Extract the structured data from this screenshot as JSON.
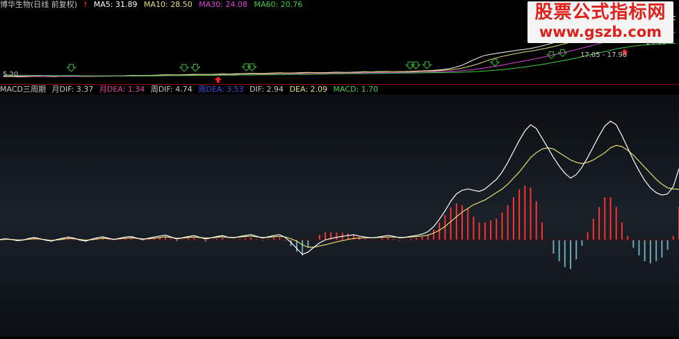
{
  "header": {
    "title": "博华生物(日线 前复权)",
    "ma5": "MA5: 31.89",
    "ma10": "MA10: 28.50",
    "ma30": "MA30: 24.08",
    "ma60": "MA60: 20.76"
  },
  "price_labels": {
    "low": "5.20",
    "right": "24.10",
    "mid": "17.05 - 17.90"
  },
  "macd_legend": {
    "name": "MACD三周期",
    "month_dif": "月DIF: 3.37",
    "month_dea": "月DEA: 1.34",
    "week_dif": "周DIF: 4.74",
    "week_dea": "周DEA: 3.53",
    "dif": "DIF: 2.94",
    "dea": "DEA: 2.09",
    "macd": "MACD: 1.70"
  },
  "watermark": {
    "title": "股票公式指标网",
    "url": "www.gszb.com"
  },
  "colors": {
    "ma5": "#ffffff",
    "ma10": "#e8e070",
    "ma30": "#e040e0",
    "ma60": "#40d040",
    "up_arrow": "#ff2020",
    "down_arrow": "#30c030",
    "month_band": "#c81e68",
    "week_band": "#5a0a12",
    "dif": "#ffffff",
    "dea": "#e8e070",
    "bar_up": "#ff3030",
    "bar_down": "#6fa8b8"
  },
  "chart_data": [
    {
      "type": "line",
      "ylim": [
        4,
        36
      ],
      "x_count": 120,
      "series": [
        {
          "values": [
            5.2,
            5.3,
            5.2,
            5.1,
            5.2,
            5.3,
            5.4,
            5.3,
            5.2,
            5.2,
            5.3,
            5.4,
            5.5,
            5.4,
            5.3,
            5.3,
            5.4,
            5.5,
            5.6,
            5.5,
            5.5,
            5.6,
            5.7,
            5.8,
            5.7,
            5.7,
            5.8,
            5.9,
            6.0,
            6.1,
            6.0,
            6.0,
            6.1,
            6.2,
            6.3,
            6.2,
            6.2,
            6.3,
            6.4,
            6.5,
            6.4,
            6.5,
            6.6,
            6.7,
            6.8,
            6.7,
            6.7,
            6.8,
            6.9,
            7.0,
            6.9,
            6.9,
            7.0,
            7.1,
            7.2,
            7.1,
            7.0,
            7.1,
            7.2,
            7.3,
            7.2,
            7.2,
            7.3,
            7.4,
            7.5,
            7.4,
            7.5,
            7.6,
            7.7,
            7.6,
            7.5,
            7.6,
            7.7,
            7.8,
            7.9,
            8.0,
            8.1,
            8.3,
            8.6,
            9.0,
            9.6,
            10.4,
            11.5,
            12.8,
            14.0,
            15.0,
            15.6,
            16.0,
            16.4,
            16.8,
            17.2,
            17.6,
            17.9,
            18.3,
            18.8,
            19.4,
            20.1,
            20.8,
            21.6,
            22.4,
            23.2,
            24.0,
            24.9,
            25.8,
            26.6,
            27.4,
            28.2,
            29.0,
            29.8,
            30.5,
            31.0,
            31.4,
            31.7,
            31.9,
            32.2,
            32.5,
            32.8,
            33.0,
            33.3,
            33.5
          ]
        },
        {
          "values": [
            5.3,
            5.3,
            5.3,
            5.2,
            5.2,
            5.3,
            5.3,
            5.3,
            5.3,
            5.2,
            5.3,
            5.3,
            5.4,
            5.4,
            5.4,
            5.3,
            5.4,
            5.4,
            5.5,
            5.5,
            5.5,
            5.5,
            5.6,
            5.7,
            5.7,
            5.7,
            5.7,
            5.8,
            5.9,
            6.0,
            6.0,
            6.0,
            6.0,
            6.1,
            6.2,
            6.2,
            6.2,
            6.2,
            6.3,
            6.4,
            6.4,
            6.4,
            6.5,
            6.6,
            6.7,
            6.7,
            6.7,
            6.7,
            6.8,
            6.9,
            6.9,
            6.9,
            6.9,
            7.0,
            7.1,
            7.1,
            7.0,
            7.0,
            7.1,
            7.2,
            7.2,
            7.2,
            7.2,
            7.3,
            7.4,
            7.4,
            7.4,
            7.5,
            7.6,
            7.6,
            7.5,
            7.5,
            7.6,
            7.7,
            7.8,
            7.9,
            7.9,
            8.0,
            8.2,
            8.4,
            8.7,
            9.1,
            9.7,
            10.4,
            11.2,
            12.1,
            13.0,
            13.8,
            14.5,
            15.1,
            15.7,
            16.2,
            16.7,
            17.1,
            17.5,
            18.0,
            18.5,
            19.1,
            19.7,
            20.4,
            21.1,
            21.8,
            22.6,
            23.4,
            24.2,
            25.0,
            25.8,
            26.6,
            27.4,
            28.1,
            28.5,
            29.0,
            29.4,
            29.8,
            30.2,
            30.6,
            31.0,
            31.4,
            31.7,
            32.0
          ]
        },
        {
          "values": [
            5.6,
            5.6,
            5.5,
            5.5,
            5.5,
            5.5,
            5.5,
            5.4,
            5.4,
            5.4,
            5.4,
            5.4,
            5.4,
            5.4,
            5.4,
            5.4,
            5.4,
            5.4,
            5.4,
            5.4,
            5.5,
            5.5,
            5.5,
            5.5,
            5.5,
            5.5,
            5.6,
            5.6,
            5.6,
            5.7,
            5.7,
            5.7,
            5.8,
            5.8,
            5.8,
            5.9,
            5.9,
            5.9,
            6.0,
            6.0,
            6.1,
            6.1,
            6.1,
            6.2,
            6.2,
            6.3,
            6.3,
            6.3,
            6.4,
            6.4,
            6.5,
            6.5,
            6.5,
            6.6,
            6.6,
            6.7,
            6.7,
            6.7,
            6.8,
            6.8,
            6.8,
            6.9,
            6.9,
            6.9,
            7.0,
            7.0,
            7.0,
            7.1,
            7.1,
            7.1,
            7.2,
            7.2,
            7.2,
            7.3,
            7.3,
            7.4,
            7.4,
            7.5,
            7.6,
            7.7,
            7.8,
            8.0,
            8.2,
            8.5,
            8.8,
            9.2,
            9.6,
            10.0,
            10.5,
            11.0,
            11.5,
            12.0,
            12.5,
            13.0,
            13.5,
            14.0,
            14.6,
            15.2,
            15.8,
            16.4,
            17.0,
            17.6,
            18.3,
            19.0,
            19.7,
            20.4,
            21.1,
            21.8,
            22.5,
            23.1,
            23.5,
            23.8,
            24.0,
            24.2,
            24.5,
            24.8,
            25.1,
            25.4,
            25.7,
            26.0
          ]
        },
        {
          "values": [
            6.0,
            6.0,
            5.9,
            5.9,
            5.9,
            5.8,
            5.8,
            5.8,
            5.8,
            5.7,
            5.7,
            5.7,
            5.7,
            5.7,
            5.6,
            5.6,
            5.6,
            5.6,
            5.6,
            5.6,
            5.6,
            5.6,
            5.6,
            5.6,
            5.6,
            5.6,
            5.6,
            5.6,
            5.7,
            5.7,
            5.7,
            5.7,
            5.7,
            5.7,
            5.8,
            5.8,
            5.8,
            5.8,
            5.9,
            5.9,
            5.9,
            5.9,
            6.0,
            6.0,
            6.0,
            6.1,
            6.1,
            6.1,
            6.1,
            6.2,
            6.2,
            6.2,
            6.3,
            6.3,
            6.3,
            6.4,
            6.4,
            6.4,
            6.5,
            6.5,
            6.5,
            6.6,
            6.6,
            6.6,
            6.6,
            6.7,
            6.7,
            6.7,
            6.8,
            6.8,
            6.8,
            6.9,
            6.9,
            6.9,
            7.0,
            7.0,
            7.0,
            7.1,
            7.1,
            7.2,
            7.2,
            7.3,
            7.4,
            7.5,
            7.6,
            7.8,
            8.0,
            8.2,
            8.4,
            8.7,
            9.0,
            9.3,
            9.6,
            10.0,
            10.4,
            10.8,
            11.2,
            11.7,
            12.2,
            12.7,
            13.2,
            13.7,
            14.3,
            14.9,
            15.5,
            16.1,
            16.7,
            17.3,
            17.9,
            18.5,
            18.9,
            19.3,
            19.7,
            20.0,
            20.2,
            20.4,
            20.6,
            20.7,
            20.8,
            20.8
          ]
        }
      ]
    },
    {
      "type": "area",
      "ylim": [
        -4,
        6
      ],
      "x_count": 120,
      "series": [
        {
          "values": [
            0.02,
            0.04,
            0.02,
            -0.02,
            0.0,
            0.05,
            0.08,
            0.04,
            0.0,
            -0.04,
            0.02,
            0.06,
            0.1,
            0.06,
            0.0,
            -0.04,
            0.03,
            0.08,
            0.12,
            0.06,
            0.02,
            0.06,
            0.1,
            0.12,
            0.06,
            0.02,
            0.06,
            0.1,
            0.14,
            0.18,
            0.1,
            0.04,
            0.08,
            0.12,
            0.16,
            0.1,
            0.04,
            0.08,
            0.12,
            0.16,
            0.1,
            0.08,
            0.12,
            0.16,
            0.2,
            0.14,
            0.08,
            0.12,
            0.16,
            0.2,
            0.12,
            0.0,
            -0.1,
            -0.25,
            -0.2,
            -0.1,
            -0.05,
            0.0,
            0.05,
            0.1,
            0.14,
            0.18,
            0.2,
            0.16,
            0.12,
            0.08,
            0.1,
            0.14,
            0.18,
            0.14,
            0.08,
            0.1,
            0.14,
            0.18,
            0.22,
            0.3,
            0.45,
            0.7,
            1.0,
            1.3,
            1.45,
            1.6,
            1.75,
            1.9,
            2.0,
            2.1,
            2.25,
            2.35,
            2.5,
            2.7,
            2.95,
            3.2,
            3.5,
            3.8,
            4.1,
            4.45,
            4.8,
            5.1,
            5.5,
            5.85,
            6.0,
            5.9,
            5.75,
            5.55,
            5.3,
            5.05,
            4.8,
            4.6,
            4.5,
            4.45,
            4.4,
            4.4,
            4.45,
            4.5,
            4.6,
            4.7,
            4.85,
            5.0,
            5.2,
            5.4
          ]
        },
        {
          "values": [
            0.0,
            0.01,
            0.0,
            -0.01,
            0.0,
            0.02,
            0.03,
            0.02,
            0.0,
            -0.02,
            0.0,
            0.02,
            0.04,
            0.02,
            0.0,
            -0.02,
            0.01,
            0.03,
            0.05,
            0.03,
            0.01,
            0.03,
            0.04,
            0.05,
            0.03,
            0.01,
            0.03,
            0.04,
            0.06,
            0.08,
            0.05,
            0.02,
            0.04,
            0.06,
            0.07,
            0.05,
            0.02,
            0.04,
            0.06,
            0.07,
            0.05,
            0.04,
            0.06,
            0.07,
            0.09,
            0.07,
            0.04,
            0.06,
            0.07,
            0.09,
            0.06,
            0.02,
            -0.02,
            -0.08,
            -0.07,
            -0.04,
            -0.02,
            0.0,
            0.02,
            0.04,
            0.06,
            0.08,
            0.09,
            0.08,
            0.06,
            0.04,
            0.05,
            0.06,
            0.08,
            0.06,
            0.04,
            0.05,
            0.06,
            0.08,
            0.1,
            0.13,
            0.2,
            0.3,
            0.45,
            0.6,
            0.7,
            0.78,
            0.85,
            0.93,
            1.0,
            1.06,
            1.14,
            1.2,
            1.28,
            1.4,
            1.52,
            1.66,
            1.82,
            2.0,
            2.2,
            2.4,
            2.62,
            2.85,
            3.1,
            3.35,
            3.55,
            3.65,
            3.7,
            3.7,
            3.66,
            3.6,
            3.52,
            3.44,
            3.38,
            3.34,
            3.3,
            3.28,
            3.28,
            3.3,
            3.33,
            3.36,
            3.4,
            3.45,
            3.5,
            3.53
          ]
        },
        {
          "values": [
            0.02,
            0.05,
            0.02,
            -0.03,
            -0.01,
            0.06,
            0.1,
            0.05,
            -0.01,
            -0.05,
            0.02,
            0.07,
            0.12,
            0.07,
            0.0,
            -0.05,
            0.03,
            0.09,
            0.13,
            0.07,
            0.02,
            0.07,
            0.12,
            0.14,
            0.07,
            0.02,
            0.07,
            0.12,
            0.16,
            0.2,
            0.12,
            0.04,
            0.09,
            0.14,
            0.18,
            0.11,
            0.04,
            0.09,
            0.14,
            0.18,
            0.11,
            0.09,
            0.14,
            0.18,
            0.22,
            0.15,
            0.08,
            0.13,
            0.18,
            0.22,
            0.1,
            -0.1,
            -0.35,
            -0.6,
            -0.5,
            -0.3,
            -0.12,
            0.0,
            0.06,
            0.11,
            0.15,
            0.19,
            0.21,
            0.16,
            0.12,
            0.09,
            0.11,
            0.15,
            0.19,
            0.15,
            0.09,
            0.11,
            0.15,
            0.19,
            0.24,
            0.34,
            0.55,
            0.85,
            1.2,
            1.6,
            1.9,
            2.05,
            2.1,
            2.05,
            2.0,
            2.1,
            2.3,
            2.5,
            2.8,
            3.2,
            3.65,
            4.1,
            4.5,
            4.75,
            4.6,
            4.2,
            3.8,
            3.4,
            3.05,
            2.75,
            2.55,
            2.7,
            3.0,
            3.4,
            3.85,
            4.3,
            4.7,
            4.9,
            4.75,
            4.3,
            3.8,
            3.3,
            2.85,
            2.45,
            2.15,
            1.95,
            1.85,
            1.9,
            2.2,
            2.94
          ]
        },
        {
          "values": [
            0.01,
            0.03,
            0.02,
            0.0,
            0.0,
            0.03,
            0.05,
            0.04,
            0.01,
            -0.02,
            0.0,
            0.03,
            0.06,
            0.05,
            0.02,
            -0.01,
            0.01,
            0.04,
            0.07,
            0.05,
            0.03,
            0.05,
            0.07,
            0.09,
            0.07,
            0.04,
            0.05,
            0.07,
            0.1,
            0.13,
            0.1,
            0.07,
            0.08,
            0.1,
            0.12,
            0.1,
            0.08,
            0.09,
            0.11,
            0.13,
            0.11,
            0.1,
            0.12,
            0.14,
            0.16,
            0.13,
            0.1,
            0.11,
            0.13,
            0.15,
            0.12,
            0.05,
            -0.05,
            -0.2,
            -0.3,
            -0.3,
            -0.25,
            -0.2,
            -0.14,
            -0.08,
            -0.03,
            0.02,
            0.06,
            0.08,
            0.09,
            0.09,
            0.1,
            0.11,
            0.12,
            0.12,
            0.11,
            0.11,
            0.12,
            0.14,
            0.16,
            0.2,
            0.28,
            0.4,
            0.56,
            0.76,
            0.96,
            1.15,
            1.3,
            1.45,
            1.55,
            1.65,
            1.8,
            1.95,
            2.1,
            2.3,
            2.55,
            2.8,
            3.1,
            3.4,
            3.6,
            3.75,
            3.8,
            3.75,
            3.6,
            3.45,
            3.3,
            3.2,
            3.15,
            3.2,
            3.3,
            3.45,
            3.6,
            3.8,
            3.9,
            3.85,
            3.7,
            3.5,
            3.25,
            3.0,
            2.75,
            2.5,
            2.3,
            2.15,
            2.1,
            2.09
          ]
        }
      ]
    }
  ]
}
